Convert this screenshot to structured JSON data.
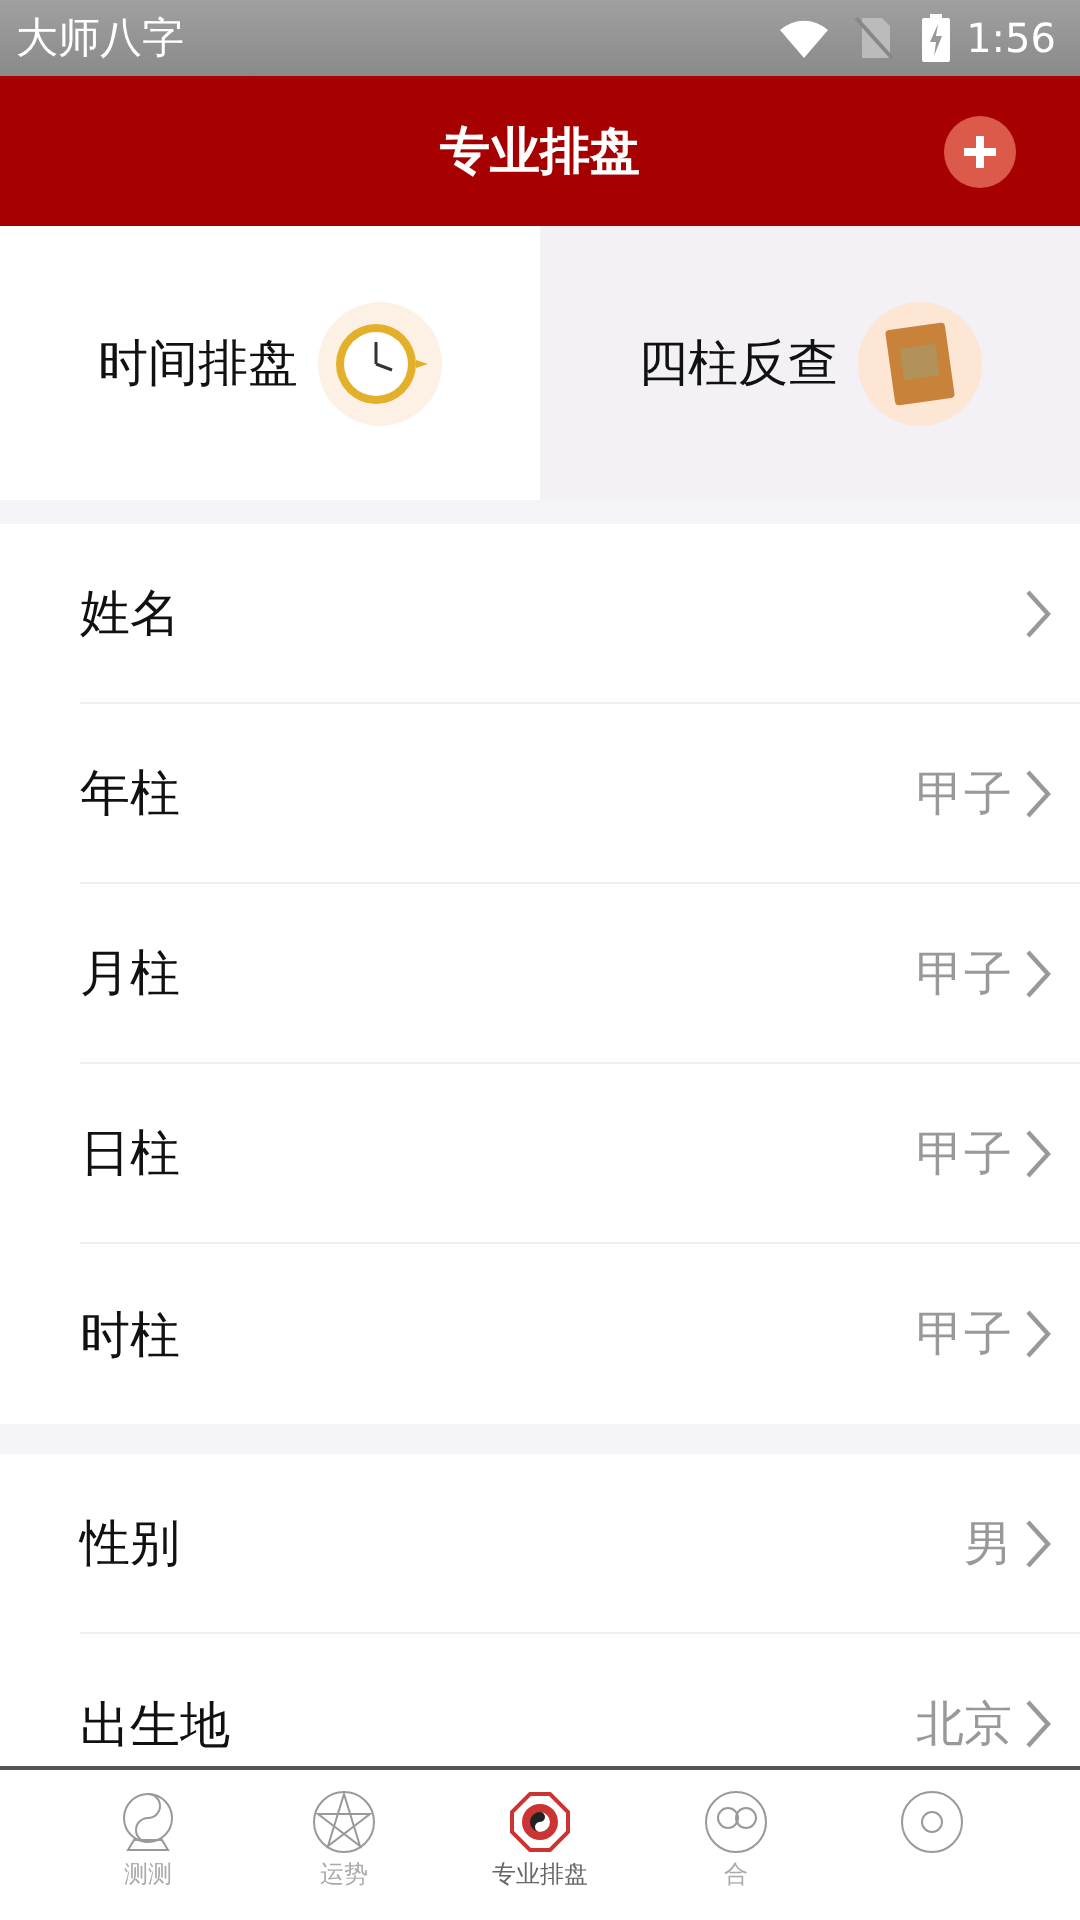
{
  "status_bar": {
    "app_name": "大师八字",
    "time": "1:56"
  },
  "header": {
    "title": "专业排盘"
  },
  "mode_tabs": [
    {
      "label": "时间排盘",
      "kind": "clock",
      "selected": true
    },
    {
      "label": "四柱反查",
      "kind": "book",
      "selected": false
    }
  ],
  "sections": [
    {
      "rows": [
        {
          "label": "姓名"
        },
        {
          "label": "年柱",
          "value": "甲子"
        },
        {
          "label": "月柱",
          "value": "甲子"
        },
        {
          "label": "日柱",
          "value": "甲子"
        },
        {
          "label": "时柱",
          "value": "甲子"
        }
      ]
    },
    {
      "rows": [
        {
          "label": "性别",
          "value": "男"
        },
        {
          "label": "出生地",
          "value": "北京"
        }
      ]
    }
  ],
  "bottom_nav": [
    {
      "label": "测测",
      "kind": "yinyang-globe",
      "selected": false
    },
    {
      "label": "运势",
      "kind": "pentagram",
      "selected": false
    },
    {
      "label": "专业排盘",
      "kind": "bagua",
      "selected": true
    },
    {
      "label": "合",
      "kind": "people",
      "selected": false
    },
    {
      "kind": "disc",
      "selected": false
    }
  ]
}
